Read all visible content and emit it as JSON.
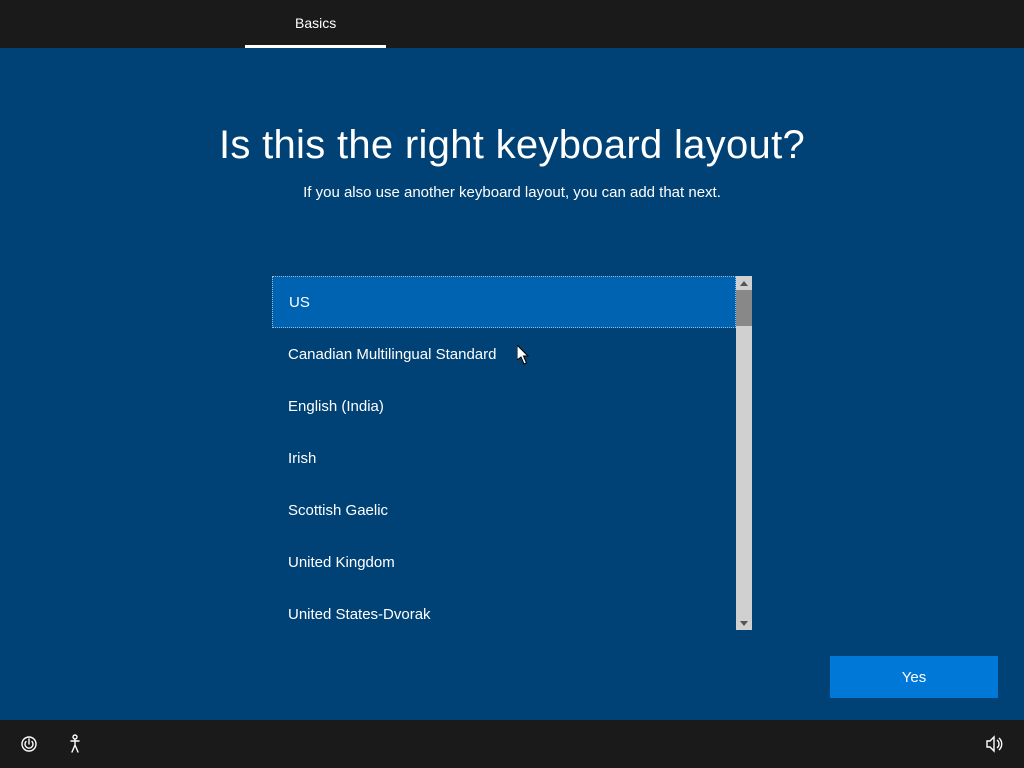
{
  "tab": {
    "label": "Basics"
  },
  "title": "Is this the right keyboard layout?",
  "subtitle": "If you also use another keyboard layout, you can add that next.",
  "layouts": [
    {
      "label": "US",
      "selected": true
    },
    {
      "label": "Canadian Multilingual Standard",
      "selected": false
    },
    {
      "label": "English (India)",
      "selected": false
    },
    {
      "label": "Irish",
      "selected": false
    },
    {
      "label": "Scottish Gaelic",
      "selected": false
    },
    {
      "label": "United Kingdom",
      "selected": false
    },
    {
      "label": "United States-Dvorak",
      "selected": false
    }
  ],
  "confirm": {
    "label": "Yes"
  }
}
